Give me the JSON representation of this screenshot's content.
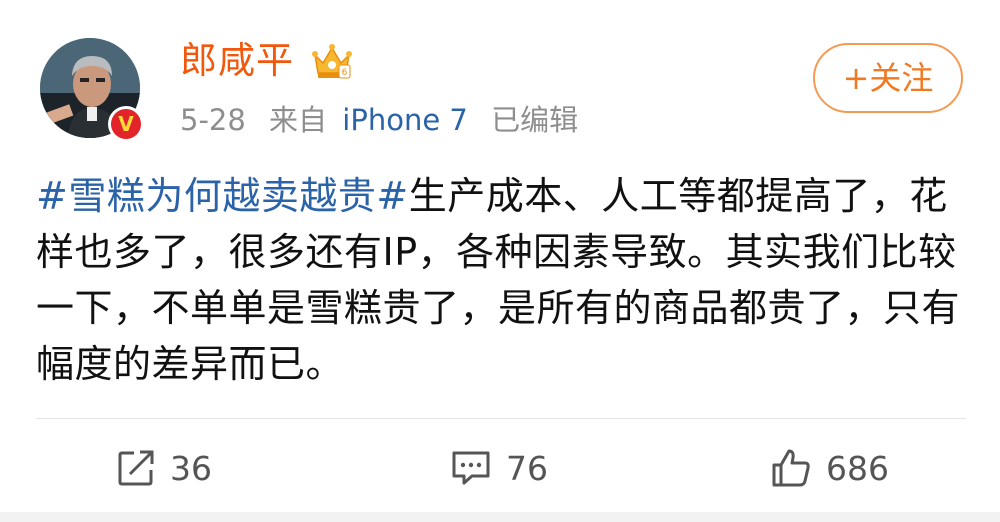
{
  "post": {
    "username": "郎咸平",
    "date": "5-28",
    "source_prefix": "来自",
    "device": "iPhone 7",
    "edited": "已编辑",
    "follow_label": "+关注",
    "topic": "#雪糕为何越卖越贵#",
    "body": "生产成本、人工等都提高了，花样也多了，很多还有IP，各种因素导致。其实我们比较一下，不单单是雪糕贵了，是所有的商品都贵了，只有幅度的差异而已。",
    "verified_mark": "V"
  },
  "actions": {
    "repost_count": "36",
    "comment_count": "76",
    "like_count": "686"
  },
  "icons": {
    "vip": "crown-vip-icon",
    "verified": "verified-v-icon",
    "repost": "share-icon",
    "comment": "comment-icon",
    "like": "thumbs-up-icon"
  },
  "colors": {
    "username": "#f2570c",
    "link": "#2b63a8",
    "follow_border": "#f59a53",
    "verified": "#e2232a"
  }
}
